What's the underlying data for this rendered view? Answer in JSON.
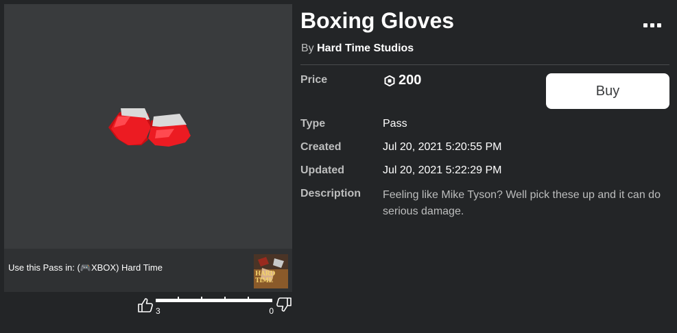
{
  "item": {
    "title": "Boxing Gloves",
    "by_prefix": "By",
    "creator": "Hard Time Studios",
    "price_label": "Price",
    "price": "200",
    "buy_label": "Buy",
    "type_label": "Type",
    "type": "Pass",
    "created_label": "Created",
    "created": "Jul 20, 2021 5:20:55 PM",
    "updated_label": "Updated",
    "updated": "Jul 20, 2021 5:22:29 PM",
    "description_label": "Description",
    "description": "Feeling like Mike Tyson? Well pick these up and it can do serious damage."
  },
  "use_in": {
    "prefix": "Use this Pass in:",
    "game_name": "(🎮XBOX) Hard Time",
    "thumb_label": "HARD TIME"
  },
  "votes": {
    "up": "3",
    "down": "0",
    "up_fraction": 1.0
  },
  "icons": {
    "more": "more-options-icon",
    "robux": "robux-icon",
    "thumbs_up": "thumbs-up-icon",
    "thumbs_down": "thumbs-down-icon"
  },
  "colors": {
    "background": "#232527",
    "panel": "#393b3d",
    "glove_red": "#e8141a",
    "buy_button": "#ffffff"
  }
}
